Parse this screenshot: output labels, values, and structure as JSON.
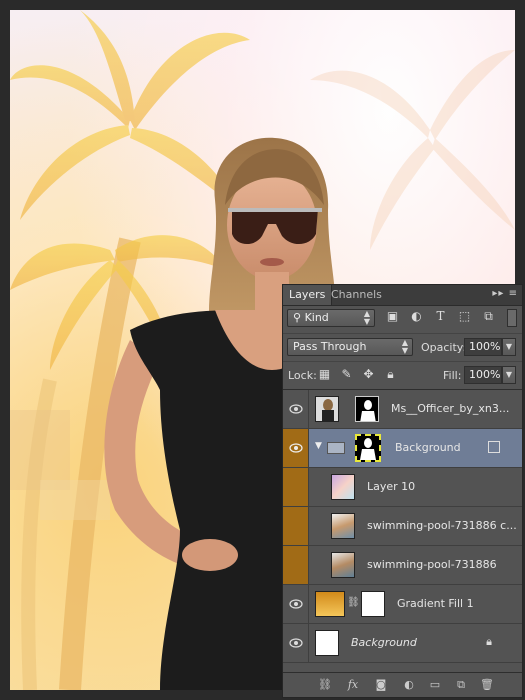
{
  "panel": {
    "tabs": [
      "Layers",
      "Channels"
    ],
    "menu_icon": "panel-menu-icon",
    "filter": {
      "kind_label": "Kind",
      "icons": [
        "pixel-filter-icon",
        "adjustment-filter-icon",
        "type-filter-icon",
        "shape-filter-icon",
        "smartobject-filter-icon"
      ]
    },
    "blend_mode": "Pass Through",
    "opacity_label": "Opacity:",
    "opacity_value": "100%",
    "lock_label": "Lock:",
    "fill_label": "Fill:",
    "fill_value": "100%",
    "layers": [
      {
        "name": "Ms__Officer_by_xn3...",
        "visible": true,
        "selected": false,
        "linked": false,
        "italic": false
      },
      {
        "name": "Background",
        "visible": true,
        "selected": true,
        "linked": true,
        "group": true,
        "italic": false
      },
      {
        "name": "Layer 10",
        "visible": true,
        "selected": false,
        "linked": true,
        "italic": false
      },
      {
        "name": "swimming-pool-731886 c...",
        "visible": true,
        "selected": false,
        "linked": true,
        "italic": false
      },
      {
        "name": "swimming-pool-731886",
        "visible": true,
        "selected": false,
        "linked": true,
        "italic": false
      },
      {
        "name": "Gradient Fill 1",
        "visible": true,
        "selected": false,
        "linked": false,
        "italic": false
      },
      {
        "name": "Background",
        "visible": true,
        "selected": false,
        "linked": false,
        "locked": true,
        "italic": true
      }
    ],
    "footer_icons": [
      "link-layers-icon",
      "fx-icon",
      "add-mask-icon",
      "adjustment-layer-icon",
      "new-group-icon",
      "new-layer-icon",
      "delete-icon"
    ],
    "fx_label": "fx"
  },
  "colors": {
    "panel_bg": "#535353",
    "selected_row": "#6f7d96",
    "linked_eye_bg": "#a16b16"
  }
}
